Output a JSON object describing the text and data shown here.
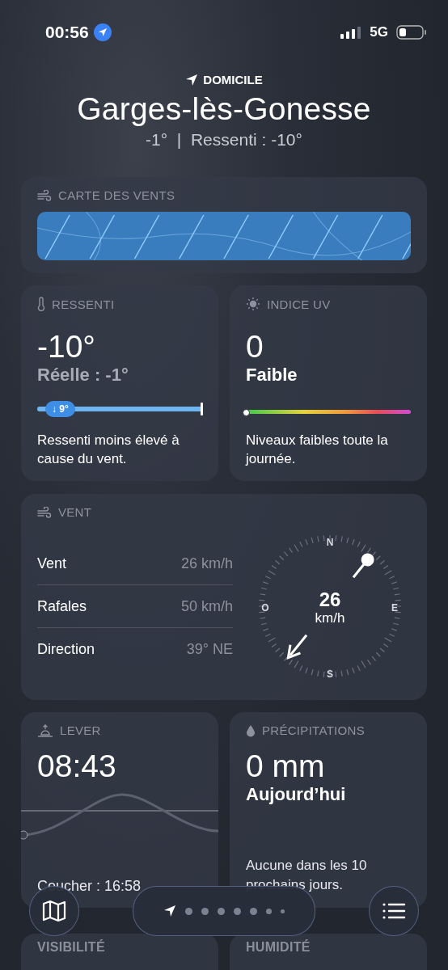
{
  "status_bar": {
    "time": "00:56",
    "network": "5G"
  },
  "header": {
    "place_label": "DOMICILE",
    "city": "Garges-lès-Gonesse",
    "summary": "-1°  |  Ressenti : -10°"
  },
  "wind_map": {
    "title": "CARTE DES VENTS"
  },
  "feels_like": {
    "title": "RESSENTI",
    "value": "-10°",
    "actual": "Réelle : -1°",
    "badge": "↓ 9°",
    "level": 1,
    "description": "Ressenti moins élevé à cause du vent."
  },
  "uv_index": {
    "title": "INDICE UV",
    "value": "0",
    "rating": "Faible",
    "level": 0,
    "description": "Niveaux faibles toute la journée."
  },
  "wind": {
    "title": "VENT",
    "rows": [
      {
        "label": "Vent",
        "value": "26 km/h"
      },
      {
        "label": "Rafales",
        "value": "50 km/h"
      },
      {
        "label": "Direction",
        "value": "39° NE"
      }
    ],
    "compass": {
      "speed": "26",
      "unit": "km/h",
      "north": "N",
      "east": "E",
      "south": "S",
      "west": "O"
    }
  },
  "sunrise": {
    "title": "LEVER",
    "value": "08:43",
    "sunset": "Coucher : 16:58"
  },
  "precipitation": {
    "title": "PRÉCIPITATIONS",
    "value": "0 mm",
    "period": "Aujourd’hui",
    "description": "Aucune dans les 10 prochains jours."
  },
  "next_cards": [
    {
      "title": "VISIBILITÉ"
    },
    {
      "title": "HUMIDITÉ"
    }
  ],
  "pages": [
    {
      "kind": "location",
      "selected": true
    },
    {
      "kind": "dot",
      "selected": false
    },
    {
      "kind": "dot",
      "selected": false
    },
    {
      "kind": "dot",
      "selected": false
    },
    {
      "kind": "dot",
      "selected": false
    },
    {
      "kind": "dot",
      "selected": false
    },
    {
      "kind": "small",
      "selected": false
    },
    {
      "kind": "tiny",
      "selected": false
    }
  ]
}
